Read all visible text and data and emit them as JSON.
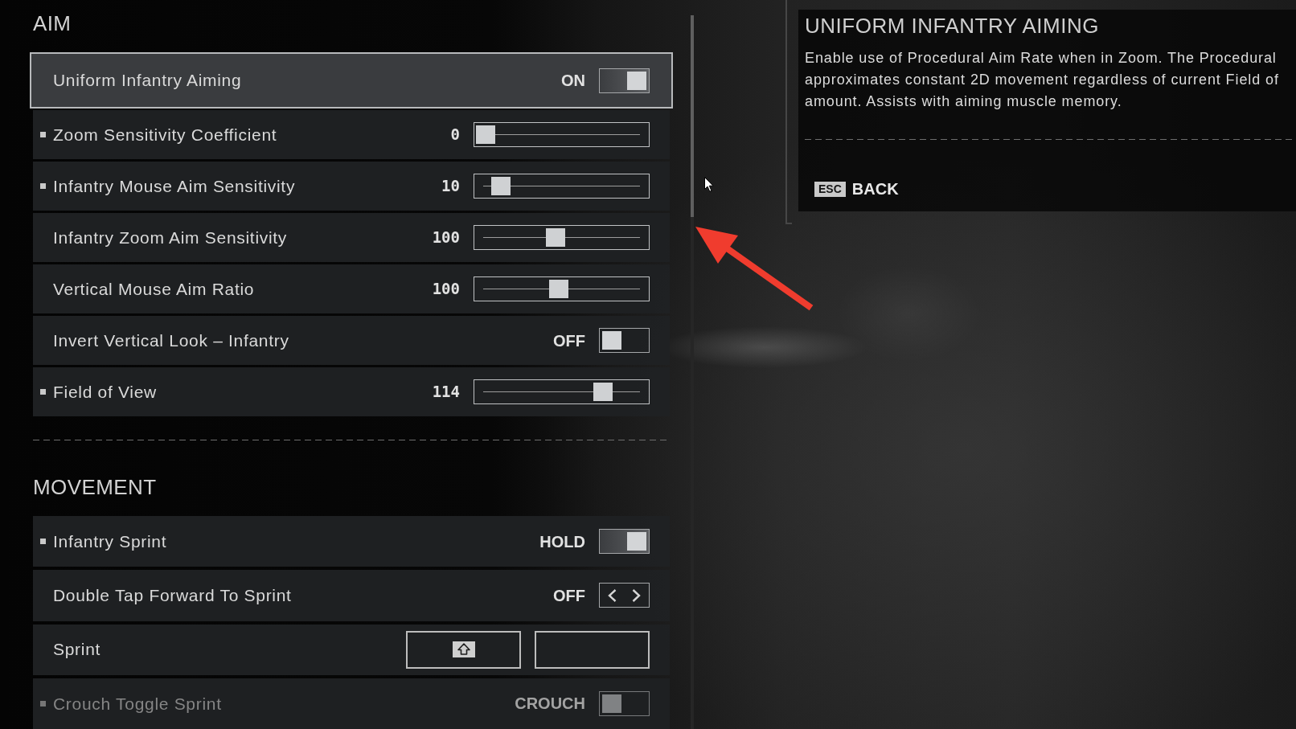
{
  "sections": [
    {
      "title": "AIM",
      "settings": [
        {
          "kind": "toggle",
          "label": "Uniform Infantry Aiming",
          "value": "ON",
          "on": true,
          "marker": false,
          "selected": true,
          "disabled": false
        },
        {
          "kind": "slider",
          "label": "Zoom Sensitivity Coefficient",
          "value": "0",
          "level": 0,
          "marker": true,
          "selected": false,
          "disabled": false
        },
        {
          "kind": "slider",
          "label": "Infantry Mouse Aim Sensitivity",
          "value": "10",
          "level": 0.1,
          "marker": true,
          "selected": false,
          "disabled": false
        },
        {
          "kind": "slider",
          "label": "Infantry Zoom Aim Sensitivity",
          "value": "100",
          "level": 0.46,
          "marker": false,
          "selected": false,
          "disabled": false
        },
        {
          "kind": "slider",
          "label": "Vertical Mouse Aim Ratio",
          "value": "100",
          "level": 0.48,
          "marker": false,
          "selected": false,
          "disabled": false
        },
        {
          "kind": "toggle",
          "label": "Invert Vertical Look – Infantry",
          "value": "OFF",
          "on": false,
          "marker": false,
          "selected": false,
          "disabled": false
        },
        {
          "kind": "slider",
          "label": "Field of View",
          "value": "114",
          "level": 0.77,
          "marker": true,
          "selected": false,
          "disabled": false
        }
      ]
    },
    {
      "title": "MOVEMENT",
      "settings": [
        {
          "kind": "toggle",
          "label": "Infantry Sprint",
          "value": "HOLD",
          "on": true,
          "marker": true,
          "selected": false,
          "disabled": false
        },
        {
          "kind": "selector",
          "label": "Double Tap Forward To Sprint",
          "value": "OFF",
          "marker": false,
          "selected": false,
          "disabled": false
        },
        {
          "kind": "keybind",
          "label": "Sprint",
          "bindings": [
            {
              "bound": true
            },
            {
              "bound": false
            }
          ],
          "marker": false,
          "selected": false,
          "disabled": false
        },
        {
          "kind": "toggle",
          "label": "Crouch Toggle Sprint",
          "value": "CROUCH",
          "on": false,
          "marker": true,
          "selected": false,
          "disabled": true
        }
      ]
    }
  ],
  "detail": {
    "title": "UNIFORM INFANTRY AIMING",
    "lines": [
      "Enable use of Procedural Aim Rate when in Zoom. The Procedural",
      "approximates constant 2D movement regardless of current Field of",
      "amount. Assists with aiming muscle memory."
    ],
    "back": {
      "key": "ESC",
      "label": "BACK"
    }
  }
}
